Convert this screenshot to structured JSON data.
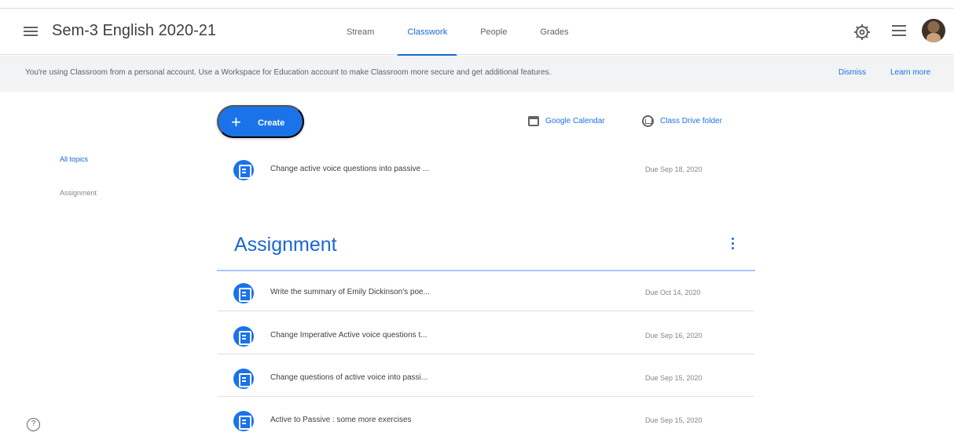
{
  "header": {
    "class_title": "Sem-3 English 2020-21",
    "tabs": [
      {
        "label": "Stream"
      },
      {
        "label": "Classwork"
      },
      {
        "label": "People"
      },
      {
        "label": "Grades"
      }
    ],
    "icons": [
      "menu-icon",
      "gear-icon",
      "apps-icon",
      "avatar"
    ]
  },
  "notice": {
    "text": "You're using Classroom from a personal account. Use a Workspace for Education account to make Classroom more secure and get additional features.",
    "dismiss_label": "Dismiss",
    "learn_more_label": "Learn more"
  },
  "toolbar": {
    "create_label": "Create",
    "calendar_label": "Google Calendar",
    "drive_label": "Class Drive folder"
  },
  "sidebar": {
    "items": [
      {
        "label": "All topics"
      },
      {
        "label": "Assignment"
      }
    ]
  },
  "main": {
    "unassigned_items": [
      {
        "title": "Change active voice questions into passive ...",
        "date": "Due Sep 18, 2020"
      }
    ],
    "section": {
      "title": "Assignment",
      "items": [
        {
          "title": "Write the summary of Emily Dickinson's poe...",
          "date": "Due Oct 14, 2020"
        },
        {
          "title": "Change Imperative Active voice questions t...",
          "date": "Due Sep 16, 2020"
        },
        {
          "title": "Change questions of active voice into passi...",
          "date": "Due Sep 15, 2020"
        },
        {
          "title": "Active to Passive : some more exercises",
          "date": "Due Sep 15, 2020"
        }
      ]
    }
  },
  "colors": {
    "accent": "#1a73e8",
    "active_tab": "#1967d2",
    "notice_background": "#f1f3f4"
  }
}
